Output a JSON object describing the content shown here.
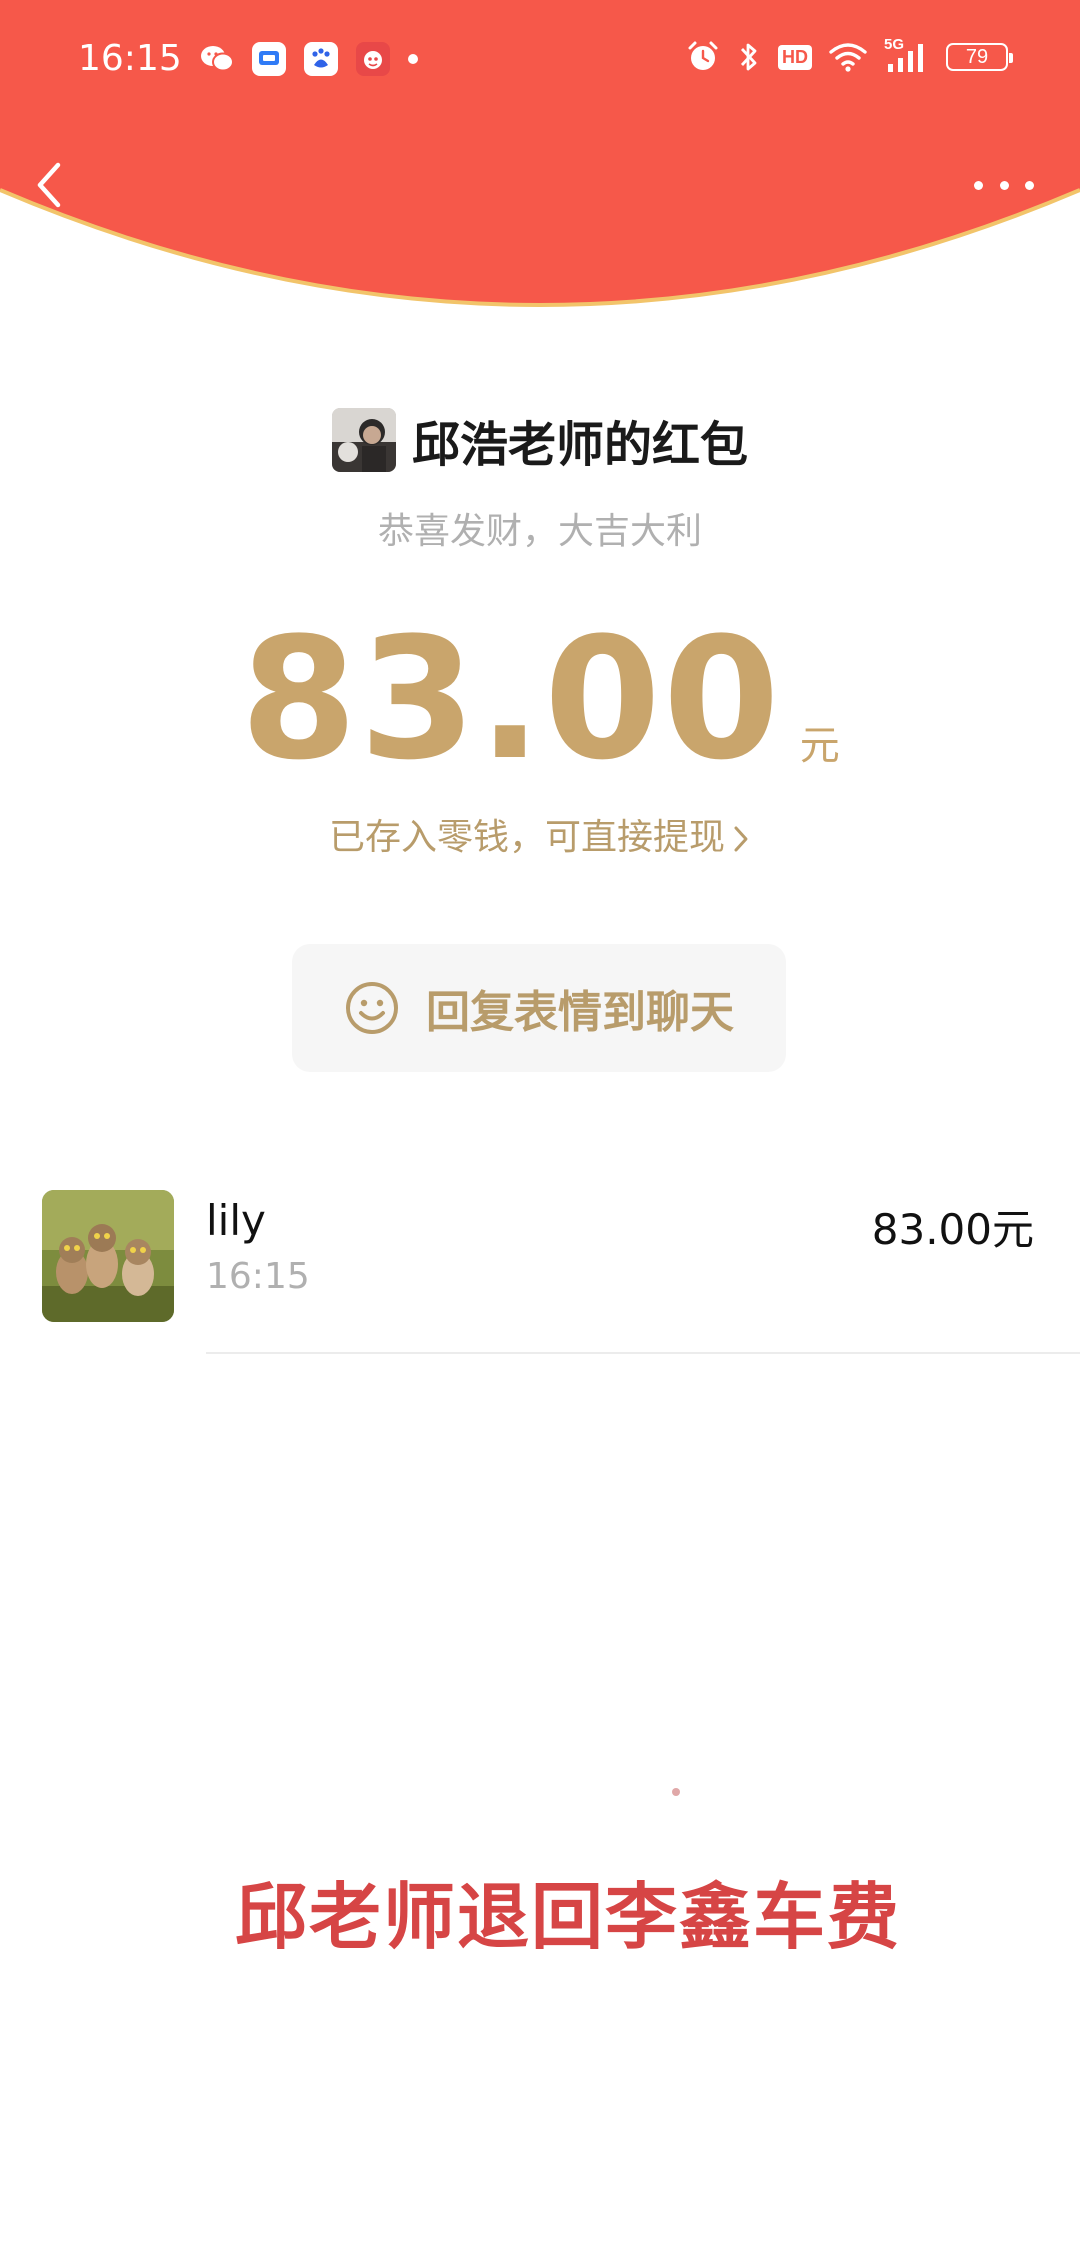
{
  "colors": {
    "header_red": "#f6584a",
    "header_edge": "#f2c46a",
    "gold": "#c9a56c",
    "gold_text": "#b89c6b",
    "caption_red": "#d64545"
  },
  "status_bar": {
    "time": "16:15",
    "app_icons": [
      "wechat-icon",
      "message-app-icon",
      "baidu-icon",
      "cartoon-app-icon"
    ],
    "status_icons": [
      "alarm-icon",
      "bluetooth-icon",
      "hd-icon",
      "wifi-icon",
      "5g-signal-icon"
    ],
    "hd_label": "HD",
    "signal_label": "5G",
    "battery": "79"
  },
  "nav": {
    "back_icon": "chevron-left-icon",
    "more_icon": "more-dots-icon"
  },
  "red_packet": {
    "title": "邱浩老师的红包",
    "greeting": "恭喜发财，大吉大利",
    "amount": "83.00",
    "unit": "元",
    "deposit_text": "已存入零钱，可直接提现",
    "reply_label": "回复表情到聊天",
    "reply_icon": "smiley-icon"
  },
  "receivers": [
    {
      "name": "lily",
      "time": "16:15",
      "amount": "83.00元"
    }
  ],
  "caption": "邱老师退回李鑫车费"
}
